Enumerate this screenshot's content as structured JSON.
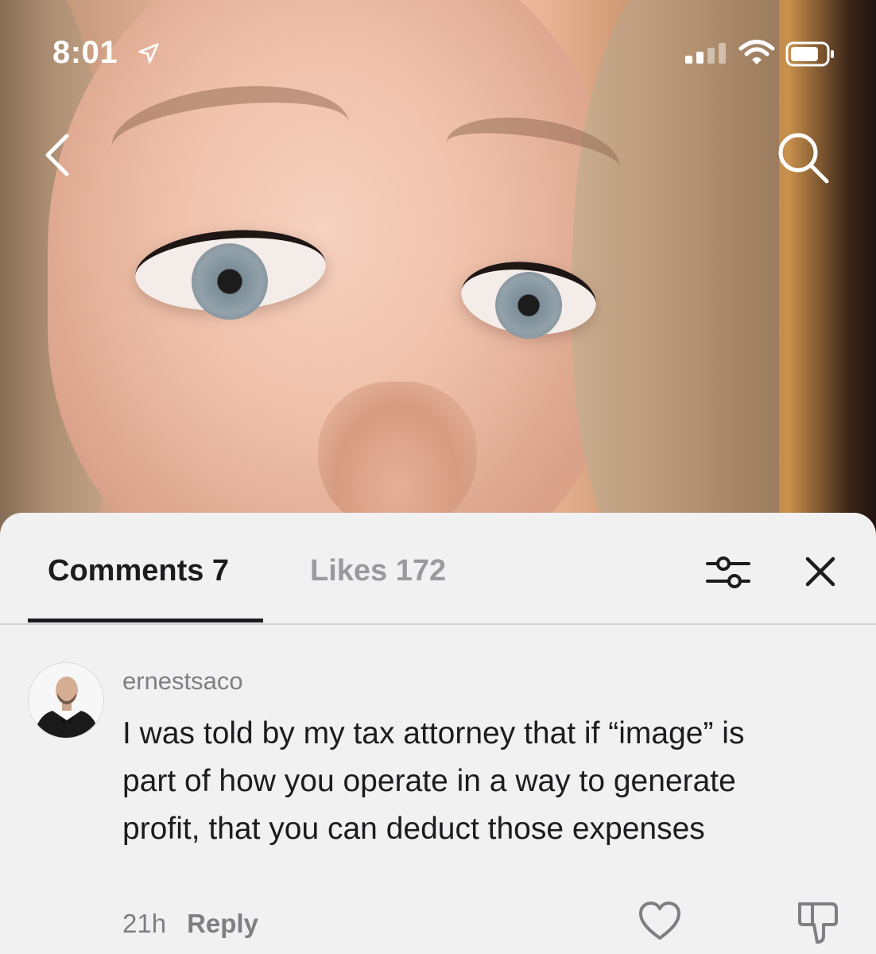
{
  "status_bar": {
    "time": "8:01",
    "icons": [
      "location-arrow-icon",
      "signal-icon",
      "wifi-icon",
      "battery-icon"
    ]
  },
  "nav": {
    "back_icon": "chevron-left-icon",
    "search_icon": "search-icon"
  },
  "comments_sheet": {
    "tabs": [
      {
        "label": "Comments 7",
        "active": true
      },
      {
        "label": "Likes 172",
        "active": false
      }
    ],
    "filter_icon": "sliders-icon",
    "close_icon": "close-icon",
    "comments": [
      {
        "username": "ernestsaco",
        "text": "I was told by my tax attorney that if “image” is part of how you operate in a way to generate profit, that you can deduct those expenses",
        "time": "21h",
        "reply_label": "Reply",
        "like_icon": "heart-icon",
        "dislike_icon": "thumbs-down-icon"
      }
    ]
  },
  "colors": {
    "sheet_background": "#f1f1f2",
    "active_tab": "#1c1c1e",
    "inactive_tab": "#9a9a9e",
    "secondary_text": "#7e7e83"
  }
}
